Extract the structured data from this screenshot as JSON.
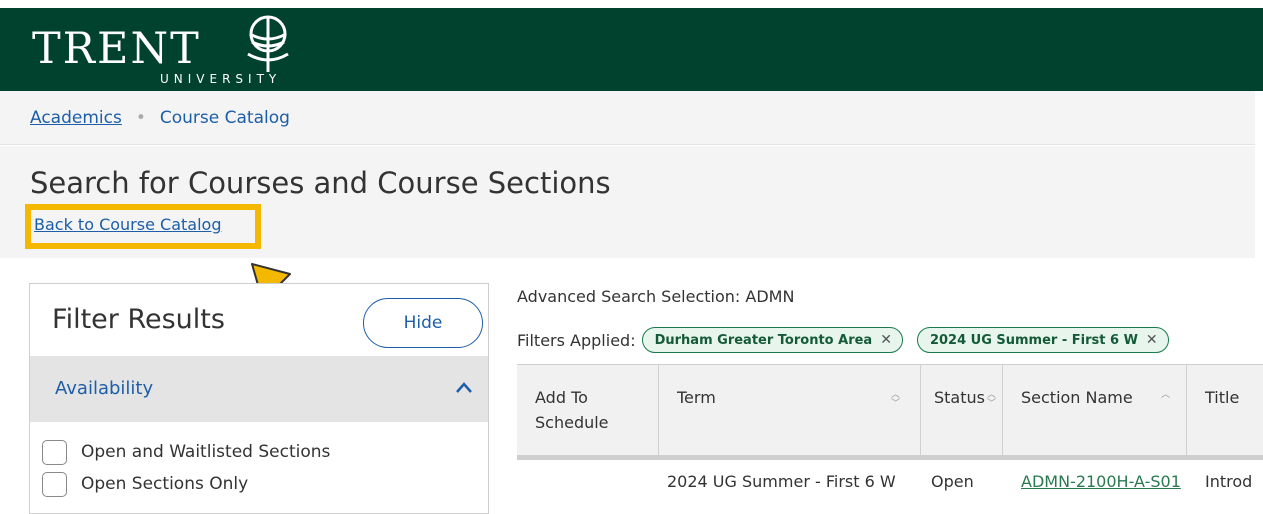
{
  "header": {
    "logo_text": "TRENT",
    "logo_sub": "UNIVERSITY",
    "bg_color": "#00422d"
  },
  "breadcrumb": {
    "items": [
      {
        "label": "Academics"
      },
      {
        "label": "Course Catalog"
      }
    ],
    "separator": "•"
  },
  "page": {
    "title": "Search for Courses and Course Sections",
    "back_link": "Back to Course Catalog",
    "highlight_color": "#f5b800"
  },
  "filter_panel": {
    "title": "Filter Results",
    "hide_label": "Hide",
    "section": {
      "label": "Availability",
      "options": [
        {
          "label": "Open and Waitlisted Sections",
          "checked": false
        },
        {
          "label": "Open Sections Only",
          "checked": false
        }
      ]
    }
  },
  "search": {
    "advanced_selection": "Advanced Search Selection: ADMN",
    "filters_label": "Filters Applied:",
    "chips": [
      {
        "label": "Durham Greater Toronto Area"
      },
      {
        "label": "2024 UG Summer - First 6 W"
      }
    ]
  },
  "table": {
    "columns": [
      "Add To Schedule",
      "Term",
      "Status",
      "Section Name",
      "Title"
    ],
    "rows": [
      {
        "add": "",
        "term": "2024 UG Summer - First 6 W",
        "status": "Open",
        "section": "ADMN-2100H-A-S01",
        "title": "Introd"
      }
    ]
  }
}
